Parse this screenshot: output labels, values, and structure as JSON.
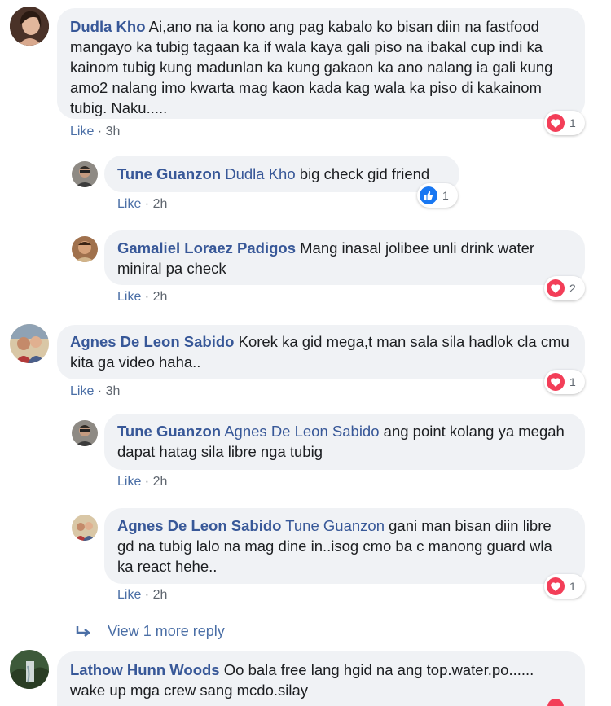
{
  "comments": [
    {
      "author": "Dudla Kho",
      "mention": "",
      "text": "Ai,ano na ia kono ang pag kabalo ko bisan diin na fastfood mangayo ka tubig tagaan ka if wala kaya gali piso na ibakal cup indi ka kainom tubig kung madunlan ka kung gakaon ka ano nalang ia gali kung amo2 nalang imo kwarta mag kaon kada kag wala ka piso di kakainom tubig. Naku.....",
      "like_label": "Like",
      "time": "3h",
      "reaction_count": "1"
    },
    {
      "author": "Tune Guanzon",
      "mention": "Dudla Kho",
      "text": "big check gid friend",
      "like_label": "Like",
      "time": "2h",
      "reaction_count": "1"
    },
    {
      "author": "Gamaliel Loraez Padigos",
      "mention": "",
      "text": "Mang inasal jolibee unli drink water miniral pa check",
      "like_label": "Like",
      "time": "2h",
      "reaction_count": "2"
    },
    {
      "author": "Agnes De Leon Sabido",
      "mention": "",
      "text": "Korek ka gid mega,t man sala sila hadlok cla cmu kita ga video haha..",
      "like_label": "Like",
      "time": "3h",
      "reaction_count": "1"
    },
    {
      "author": "Tune Guanzon",
      "mention": "Agnes De Leon Sabido",
      "text": "ang point kolang ya megah dapat hatag sila libre nga tubig",
      "like_label": "Like",
      "time": "2h"
    },
    {
      "author": "Agnes De Leon Sabido",
      "mention": "Tune Guanzon",
      "text": "gani man bisan diin libre gd na tubig lalo na mag dine in..isog cmo ba c manong guard wla ka react hehe..",
      "like_label": "Like",
      "time": "2h",
      "reaction_count": "1"
    },
    {
      "author": "Lathow Hunn Woods",
      "mention": "",
      "text": "Oo bala free lang hgid na ang top.water.po...... wake up mga crew sang mcdo.silay"
    }
  ],
  "view_more": {
    "label": "View 1 more reply"
  },
  "colors": {
    "link": "#385898",
    "bubble": "#f0f2f5",
    "heart": "#f33e58",
    "like": "#1877f2"
  }
}
